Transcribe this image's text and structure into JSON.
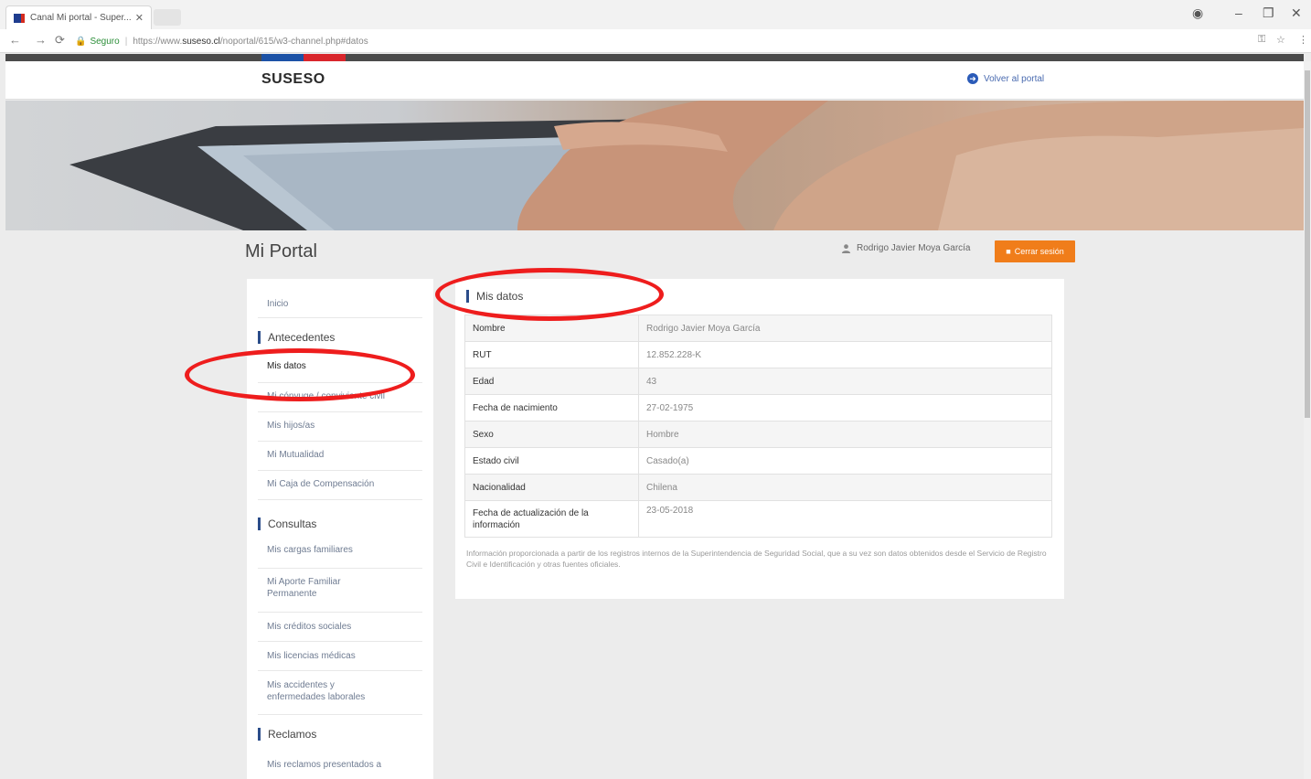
{
  "browser": {
    "tab_title": "Canal Mi portal - Super...",
    "secure_label": "Seguro",
    "url_prefix": "https://www.",
    "url_host": "suseso.cl",
    "url_path": "/noportal/615/w3-channel.php#datos"
  },
  "header": {
    "logo": "SUSESO",
    "back_link": "Volver al portal"
  },
  "page": {
    "title": "Mi Portal",
    "user_name": "Rodrigo Javier Moya García",
    "logout_label": "Cerrar sesión"
  },
  "sidebar": {
    "home": "Inicio",
    "sections": [
      {
        "title": "Antecedentes",
        "items": [
          "Mis datos",
          "Mi cónyuge / conviviente civil",
          "Mis hijos/as",
          "Mi Mutualidad",
          "Mi Caja de Compensación"
        ]
      },
      {
        "title": "Consultas",
        "items": [
          "Mis cargas familiares",
          "Mi Aporte Familiar Permanente",
          "Mis créditos sociales",
          "Mis licencias médicas",
          "Mis accidentes y enfermedades laborales"
        ]
      },
      {
        "title": "Reclamos",
        "items": [
          "Mis reclamos presentados a"
        ]
      }
    ]
  },
  "main": {
    "card_title": "Mis datos",
    "rows": [
      {
        "label": "Nombre",
        "value": "Rodrigo Javier Moya García"
      },
      {
        "label": "RUT",
        "value": "12.852.228-K"
      },
      {
        "label": "Edad",
        "value": "43"
      },
      {
        "label": "Fecha de nacimiento",
        "value": "27-02-1975"
      },
      {
        "label": "Sexo",
        "value": "Hombre"
      },
      {
        "label": "Estado civil",
        "value": "Casado(a)"
      },
      {
        "label": "Nacionalidad",
        "value": "Chilena"
      },
      {
        "label": "Fecha de actualización de la información",
        "value": "23-05-2018"
      }
    ],
    "footnote": "Información proporcionada a partir de los registros internos de la Superintendencia de Seguridad Social, que a su vez son datos obtenidos desde el Servicio de Registro Civil e Identificación y otras fuentes oficiales."
  },
  "colors": {
    "annotation_red": "#ee1d1d",
    "logout_orange": "#f07d1a",
    "accent_blue": "#2b4d8a"
  }
}
